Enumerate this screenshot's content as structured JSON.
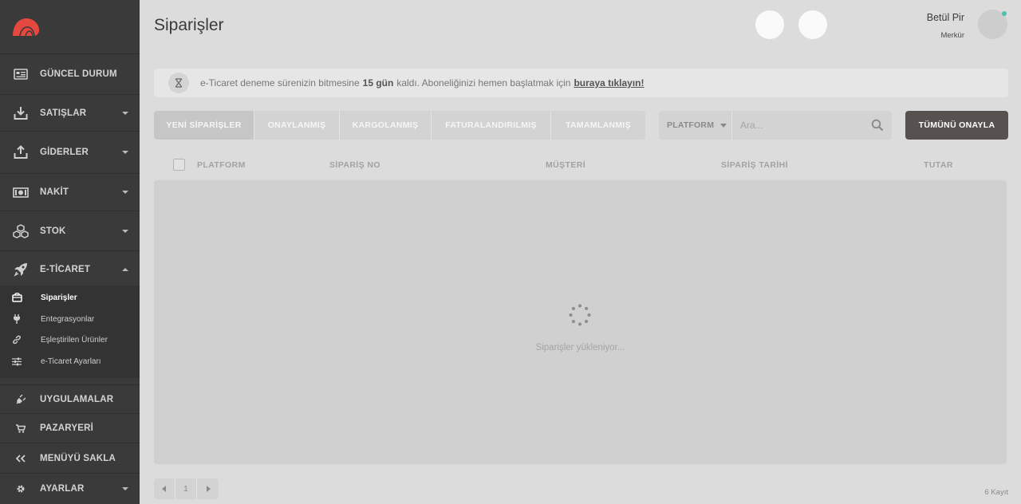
{
  "sidebar": {
    "items": [
      {
        "label": "GÜNCEL DURUM",
        "icon": "newspaper-icon"
      },
      {
        "label": "SATIŞLAR",
        "icon": "download-tray-icon"
      },
      {
        "label": "GİDERLER",
        "icon": "upload-tray-icon"
      },
      {
        "label": "NAKİT",
        "icon": "cash-icon"
      },
      {
        "label": "STOK",
        "icon": "boxes-icon"
      },
      {
        "label": "E-TİCARET",
        "icon": "rocket-icon"
      }
    ],
    "sub_items": [
      {
        "label": "Siparişler",
        "icon": "bag-icon"
      },
      {
        "label": "Entegrasyonlar",
        "icon": "plug-icon"
      },
      {
        "label": "Eşleştirilen Ürünler",
        "icon": "link-icon"
      },
      {
        "label": "e-Ticaret Ayarları",
        "icon": "sliders-icon"
      }
    ],
    "bottom_items": [
      {
        "label": "UYGULAMALAR",
        "icon": "plug-small-icon"
      },
      {
        "label": "PAZARYERİ",
        "icon": "cart-icon"
      },
      {
        "label": "MENÜYÜ SAKLA",
        "icon": "double-chevron-left-icon"
      },
      {
        "label": "AYARLAR",
        "icon": "gear-icon"
      }
    ]
  },
  "header": {
    "title": "Siparişler",
    "user_name": "Betül Pir",
    "user_org": "Merkür"
  },
  "notice": {
    "text_before": "e-Ticaret deneme sürenizin bitmesine",
    "days": "15 gün",
    "text_after": "kaldı. Aboneliğinizi hemen başlatmak için",
    "link": "buraya tıklayın!"
  },
  "tabs": [
    {
      "label": "YENİ SİPARİŞLER"
    },
    {
      "label": "ONAYLANMIŞ"
    },
    {
      "label": "KARGOLANMIŞ"
    },
    {
      "label": "FATURALANDIRILMIŞ"
    },
    {
      "label": "TAMAMLANMIŞ"
    }
  ],
  "search": {
    "platform_label": "PLATFORM",
    "placeholder": "Ara..."
  },
  "approve_all_label": "TÜMÜNÜ ONAYLA",
  "table": {
    "columns": [
      "PLATFORM",
      "SİPARİŞ NO",
      "MÜŞTERİ",
      "SİPARİŞ TARİHİ",
      "TUTAR"
    ]
  },
  "loading_text": "Siparişler yükleniyor...",
  "pagination": {
    "current_page": "1"
  },
  "record_count": "6 Kayıt",
  "colors": {
    "sidebar_bg": "#3a3a3a",
    "accent_logo": "#e5483f",
    "approve_button": "#57514f",
    "online": "#4fc0b0"
  }
}
